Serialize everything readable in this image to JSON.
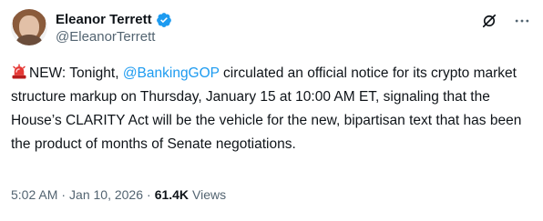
{
  "author": {
    "display_name": "Eleanor Terrett",
    "handle": "@EleanorTerrett",
    "verified": true
  },
  "icons": {
    "avatar": "avatar-image",
    "verified": "verified-badge-icon",
    "grok": "grok-icon",
    "more": "more-icon",
    "siren": "siren-emoji-icon"
  },
  "tweet": {
    "prefix": "NEW: Tonight, ",
    "mention": "@BankingGOP",
    "text": " circulated an official notice for its crypto market structure markup on Thursday, January 15 at 10:00 AM ET, signaling that the House’s CLARITY Act will be the vehicle for the new, bipartisan text that has been the product of months of Senate negotiations."
  },
  "meta": {
    "time": "5:02 AM",
    "separator": "·",
    "date": "Jan 10, 2026",
    "views_count": "61.4K",
    "views_label": "Views"
  },
  "colors": {
    "link": "#1d9bf0",
    "text": "#0f1419",
    "secondary": "#536471",
    "verified": "#1d9bf0"
  }
}
